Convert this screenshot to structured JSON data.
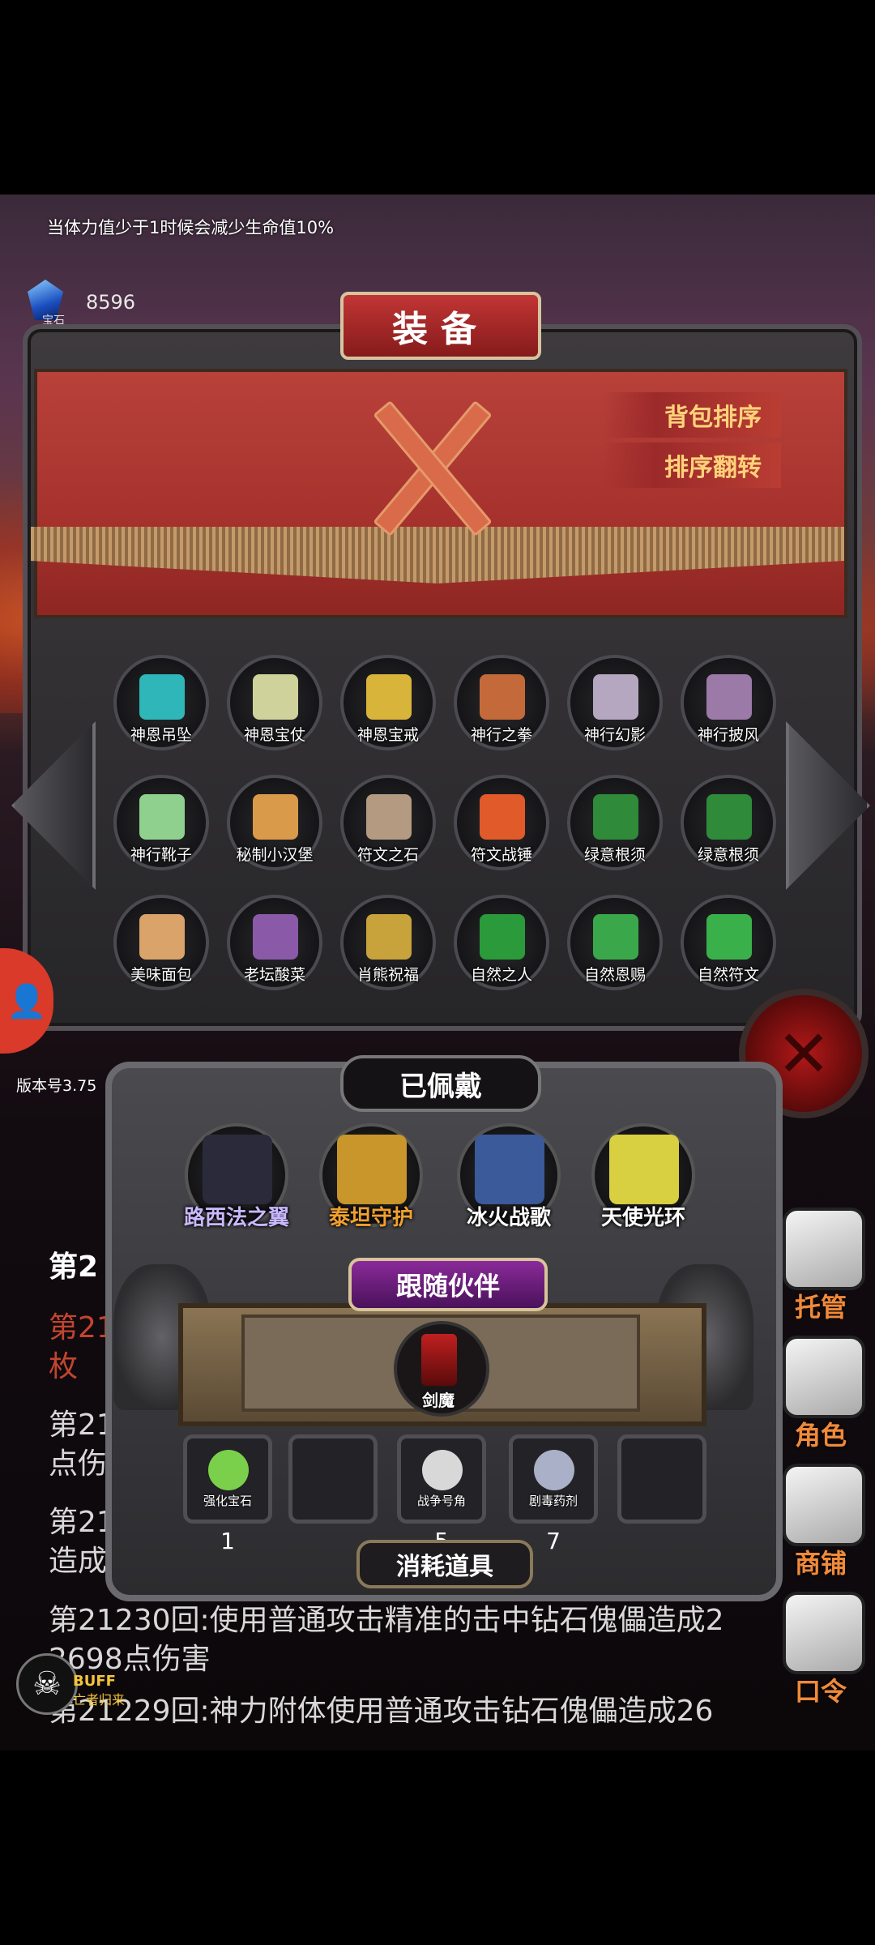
{
  "hint_text": "当体力值少于1时候会减少生命值10%",
  "gem": {
    "count": "8596",
    "label": "宝石"
  },
  "panel": {
    "title": "装备",
    "sort_button": "背包排序",
    "reverse_button": "排序翻转"
  },
  "items": [
    {
      "label": "神恩吊坠",
      "color": "#2fb6b8"
    },
    {
      "label": "神恩宝仗",
      "color": "#cfd29a"
    },
    {
      "label": "神恩宝戒",
      "color": "#d9b43a"
    },
    {
      "label": "神行之拳",
      "color": "#c46a3a"
    },
    {
      "label": "神行幻影",
      "color": "#b5a7c0"
    },
    {
      "label": "神行披风",
      "color": "#9b7aa8"
    },
    {
      "label": "神行靴子",
      "color": "#8fd08f"
    },
    {
      "label": "秘制小汉堡",
      "color": "#d99a4a"
    },
    {
      "label": "符文之石",
      "color": "#b39a80"
    },
    {
      "label": "符文战锤",
      "color": "#e05a2a"
    },
    {
      "label": "绿意根须",
      "color": "#2f8a3a"
    },
    {
      "label": "绿意根须",
      "color": "#2f8a3a"
    },
    {
      "label": "美味面包",
      "color": "#d9a36a"
    },
    {
      "label": "老坛酸菜",
      "color": "#8a5aa8"
    },
    {
      "label": "肖熊祝福",
      "color": "#c8a23a"
    },
    {
      "label": "自然之人",
      "color": "#2a9a3a"
    },
    {
      "label": "自然恩赐",
      "color": "#3aa84a"
    },
    {
      "label": "自然符文",
      "color": "#3ab04a"
    }
  ],
  "equipped": {
    "title": "已佩戴",
    "items": [
      {
        "label": "路西法之翼",
        "color": "#2a2a3a",
        "text_color": "#c9b8ff"
      },
      {
        "label": "泰坦守护",
        "color": "#c8962a",
        "text_color": "#f0a030"
      },
      {
        "label": "冰火战歌",
        "color": "#3a5a9a",
        "text_color": "#ffffff"
      },
      {
        "label": "天使光环",
        "color": "#d8d040",
        "text_color": "#ffffff"
      }
    ]
  },
  "companion": {
    "title": "跟随伙伴",
    "name": "剑魔"
  },
  "consumables": {
    "title": "消耗道具",
    "items": [
      {
        "label": "强化宝石",
        "count": "1",
        "color": "#7ad04a"
      },
      {
        "label": "",
        "count": "",
        "color": ""
      },
      {
        "label": "战争号角",
        "count": "5",
        "color": "#d8d8d8"
      },
      {
        "label": "剧毒药剂",
        "count": "7",
        "color": "#aab0c8"
      },
      {
        "label": "",
        "count": "",
        "color": ""
      }
    ]
  },
  "log": {
    "lines": [
      "第2",
      "第21",
      "枚",
      "第21",
      "点伤",
      "第21",
      "造成",
      "第21230回:使用普通攻击精准的击中钻石傀儡造成2",
      "2698点伤害",
      "第21229回:神力附体使用普通攻击钻石傀儡造成26"
    ]
  },
  "right_menu": [
    {
      "label": "托管"
    },
    {
      "label": "角色"
    },
    {
      "label": "商铺"
    },
    {
      "label": "口令"
    }
  ],
  "version": "版本号3.75",
  "buff": {
    "title": "BUFF",
    "subtitle": "亡者归来"
  },
  "close_symbol": "✕"
}
